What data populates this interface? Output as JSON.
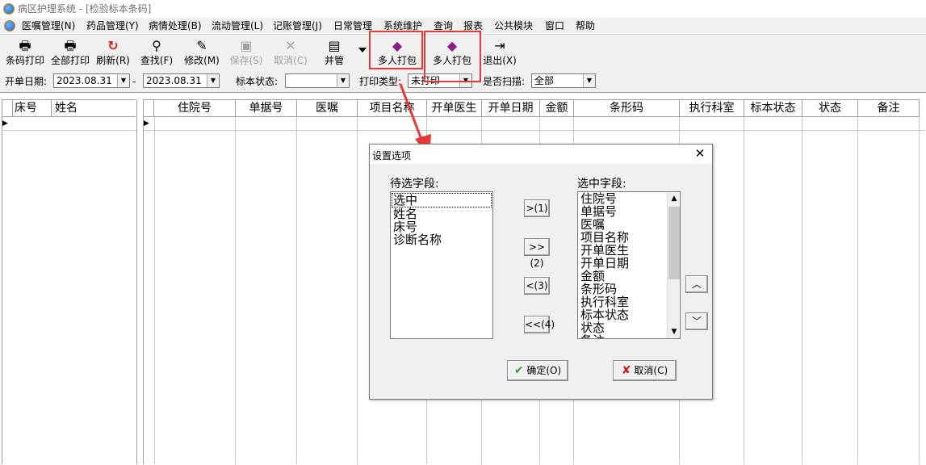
{
  "window": {
    "title": "病区护理系统 - [检验标本条码]"
  },
  "menu": [
    "医嘱管理(N)",
    "药品管理(Y)",
    "病情处理(B)",
    "流动管理(L)",
    "记账管理(J)",
    "日常管理",
    "系统维护",
    "查询",
    "报表",
    "公共模块",
    "窗口",
    "帮助"
  ],
  "toolbar": {
    "barcode_print": "条码打印",
    "print_all": "全部打印",
    "refresh": "刷新(R)",
    "find": "查找(F)",
    "modify": "修改(M)",
    "save": "保存(S)",
    "cancel": "取消(C)",
    "merge_tube": "并管",
    "multi_pack_1": "多人打包",
    "multi_pack_2": "多人打包",
    "exit": "退出(X)"
  },
  "filters": {
    "date_label": "开单日期:",
    "date_from": "2023.08.31",
    "date_sep": "-",
    "date_to": "2023.08.31",
    "status_label": "标本状态:",
    "status_value": "",
    "print_type_label": "打印类型:",
    "print_type_value": "未打印",
    "scanned_label": "是否扫描:",
    "scanned_value": "全部"
  },
  "left_grid": {
    "columns": [
      "床号",
      "姓名"
    ]
  },
  "main_grid": {
    "columns": [
      "住院号",
      "单据号",
      "医嘱",
      "项目名称",
      "开单医生",
      "开单日期",
      "金额",
      "条形码",
      "执行科室",
      "标本状态",
      "状态",
      "备注"
    ]
  },
  "dialog": {
    "title": "设置选项",
    "available_label": "待选字段:",
    "available_fields": [
      "选中",
      "姓名",
      "床号",
      "诊断名称"
    ],
    "selected_label": "选中字段:",
    "selected_fields": [
      "住院号",
      "单据号",
      "医嘱",
      "项目名称",
      "开单医生",
      "开单日期",
      "金额",
      "条形码",
      "执行科室",
      "标本状态",
      "状态",
      "备注"
    ],
    "btn_add": ">(1)",
    "btn_add_all": ">>(2)",
    "btn_remove": "<(3)",
    "btn_remove_all": "<<(4)",
    "ok": "确定(O)",
    "cancel": "取消(C)"
  },
  "colors": {
    "accent_red": "#e53935",
    "check_green": "#2e9d2e"
  }
}
